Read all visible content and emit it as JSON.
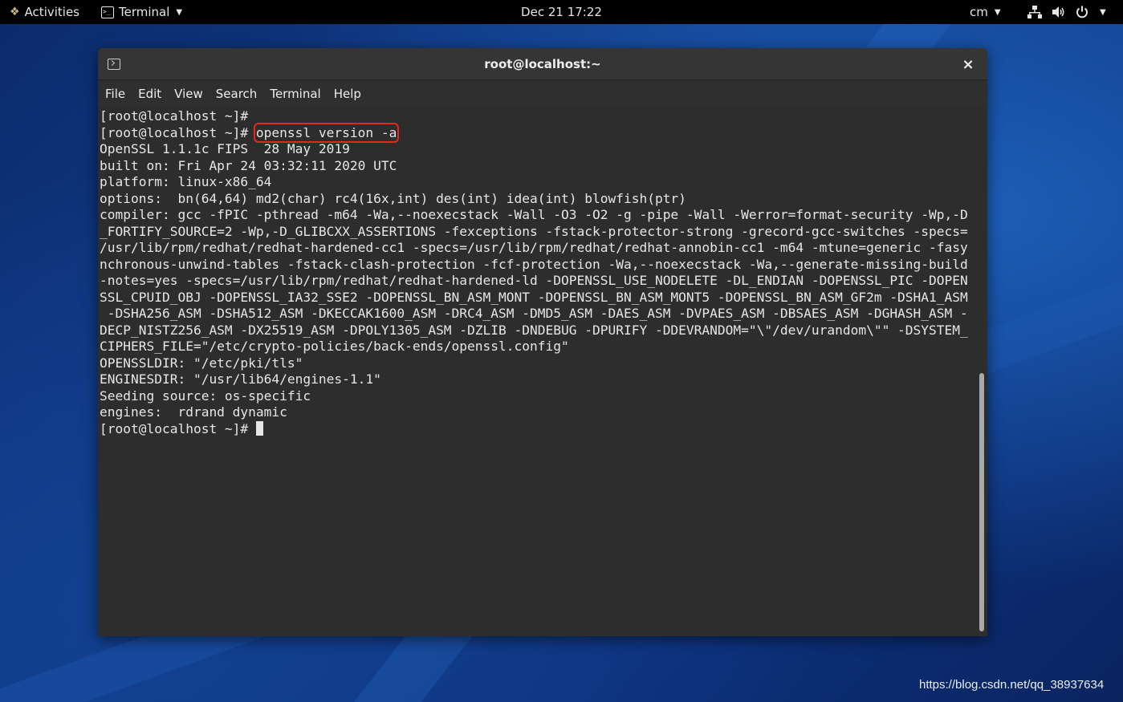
{
  "topbar": {
    "activities": "Activities",
    "app_menu": "Terminal",
    "clock": "Dec 21  17:22",
    "user": "cm",
    "icons": [
      "network-icon",
      "volume-icon",
      "power-icon"
    ]
  },
  "window": {
    "title": "root@localhost:~",
    "close_glyph": "×",
    "menu": [
      "File",
      "Edit",
      "View",
      "Search",
      "Terminal",
      "Help"
    ]
  },
  "terminal": {
    "prompt": "[root@localhost ~]# ",
    "line1": "[root@localhost ~]#",
    "command": "openssl version -a",
    "output": [
      "OpenSSL 1.1.1c FIPS  28 May 2019",
      "built on: Fri Apr 24 03:32:11 2020 UTC",
      "platform: linux-x86_64",
      "options:  bn(64,64) md2(char) rc4(16x,int) des(int) idea(int) blowfish(ptr)",
      "compiler: gcc -fPIC -pthread -m64 -Wa,--noexecstack -Wall -O3 -O2 -g -pipe -Wall -Werror=format-security -Wp,-D",
      "_FORTIFY_SOURCE=2 -Wp,-D_GLIBCXX_ASSERTIONS -fexceptions -fstack-protector-strong -grecord-gcc-switches -specs=",
      "/usr/lib/rpm/redhat/redhat-hardened-cc1 -specs=/usr/lib/rpm/redhat/redhat-annobin-cc1 -m64 -mtune=generic -fasy",
      "nchronous-unwind-tables -fstack-clash-protection -fcf-protection -Wa,--noexecstack -Wa,--generate-missing-build",
      "-notes=yes -specs=/usr/lib/rpm/redhat/redhat-hardened-ld -DOPENSSL_USE_NODELETE -DL_ENDIAN -DOPENSSL_PIC -DOPEN",
      "SSL_CPUID_OBJ -DOPENSSL_IA32_SSE2 -DOPENSSL_BN_ASM_MONT -DOPENSSL_BN_ASM_MONT5 -DOPENSSL_BN_ASM_GF2m -DSHA1_ASM",
      " -DSHA256_ASM -DSHA512_ASM -DKECCAK1600_ASM -DRC4_ASM -DMD5_ASM -DAES_ASM -DVPAES_ASM -DBSAES_ASM -DGHASH_ASM -",
      "DECP_NISTZ256_ASM -DX25519_ASM -DPOLY1305_ASM -DZLIB -DNDEBUG -DPURIFY -DDEVRANDOM=\"\\\"/dev/urandom\\\"\" -DSYSTEM_",
      "CIPHERS_FILE=\"/etc/crypto-policies/back-ends/openssl.config\"",
      "OPENSSLDIR: \"/etc/pki/tls\"",
      "ENGINESDIR: \"/usr/lib64/engines-1.1\"",
      "Seeding source: os-specific",
      "engines:  rdrand dynamic"
    ],
    "last_prompt": "[root@localhost ~]# "
  },
  "watermark": "https://blog.csdn.net/qq_38937634"
}
